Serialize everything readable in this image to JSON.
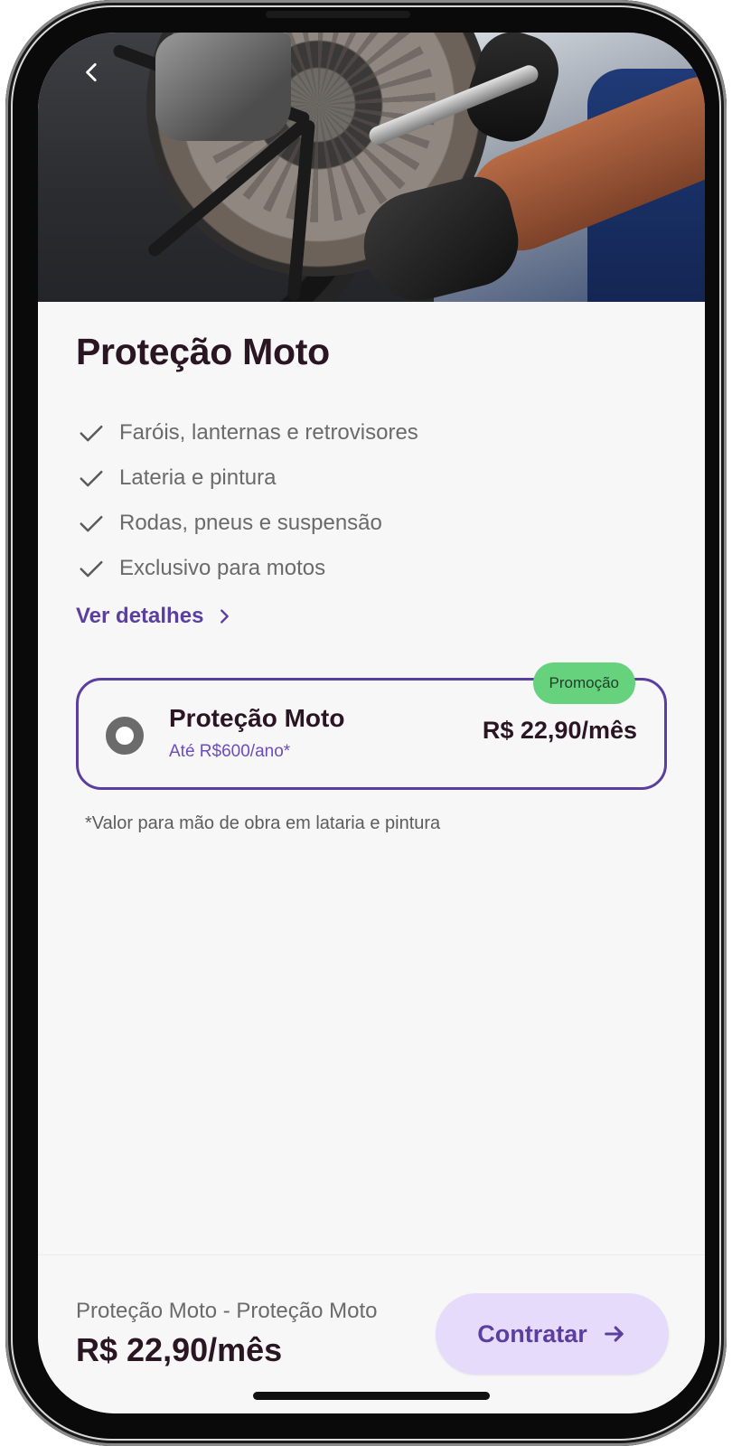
{
  "header": {
    "back_icon": "chevron-left-icon"
  },
  "product": {
    "title": "Proteção Moto",
    "features": [
      "Faróis, lanternas e retrovisores",
      "Lateria e pintura",
      "Rodas, pneus e suspensão",
      "Exclusivo para motos"
    ],
    "feature_icon": "check-icon",
    "details_label": "Ver detalhes",
    "details_icon": "chevron-right-icon"
  },
  "plan": {
    "badge": "Promoção",
    "name": "Proteção Moto",
    "limit": "Até R$600/ano*",
    "price": "R$ 22,90/mês",
    "selected": true
  },
  "footnote": "*Valor para mão de obra em lataria e pintura",
  "footer": {
    "summary_title": "Proteção Moto - Proteção Moto",
    "summary_price": "R$ 22,90/mês",
    "cta_label": "Contratar",
    "cta_icon": "arrow-right-icon"
  },
  "colors": {
    "accent": "#5b3fa0",
    "accent_light": "#e6dbfa",
    "promo": "#66d27e",
    "title_text": "#2a1522",
    "muted_text": "#6a6a6a"
  }
}
